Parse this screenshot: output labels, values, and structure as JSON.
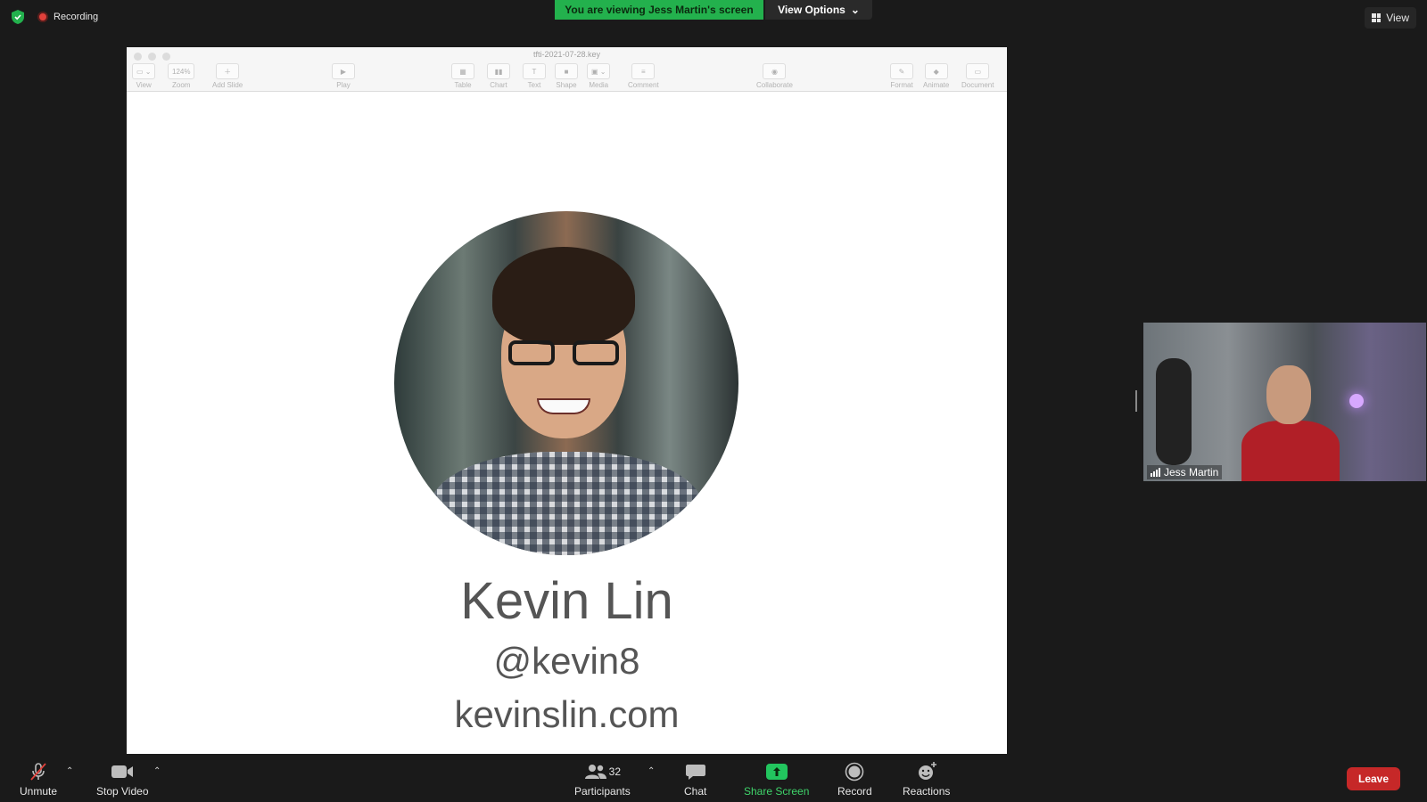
{
  "top_bar": {
    "recording_label": "Recording",
    "viewing_banner": "You are viewing Jess Martin's screen",
    "view_options_label": "View Options",
    "view_label": "View"
  },
  "keynote": {
    "document_title": "tfti-2021-07-28.key",
    "toolbar": [
      {
        "label": "View",
        "name": "view"
      },
      {
        "label": "Zoom",
        "name": "zoom",
        "value": "124%"
      },
      {
        "label": "Add Slide",
        "name": "add-slide"
      },
      {
        "label": "Play",
        "name": "play"
      },
      {
        "label": "Table",
        "name": "table"
      },
      {
        "label": "Chart",
        "name": "chart"
      },
      {
        "label": "Text",
        "name": "text"
      },
      {
        "label": "Shape",
        "name": "shape"
      },
      {
        "label": "Media",
        "name": "media"
      },
      {
        "label": "Comment",
        "name": "comment"
      },
      {
        "label": "Collaborate",
        "name": "collaborate"
      },
      {
        "label": "Format",
        "name": "format"
      },
      {
        "label": "Animate",
        "name": "animate"
      },
      {
        "label": "Document",
        "name": "document"
      }
    ]
  },
  "slide": {
    "name": "Kevin Lin",
    "handle": "@kevin8",
    "website": "kevinslin.com"
  },
  "self_view": {
    "participant_name": "Jess Martin"
  },
  "bottom_bar": {
    "unmute_label": "Unmute",
    "stop_video_label": "Stop Video",
    "participants_label": "Participants",
    "participants_count": "32",
    "chat_label": "Chat",
    "share_screen_label": "Share Screen",
    "record_label": "Record",
    "reactions_label": "Reactions",
    "leave_label": "Leave"
  },
  "colors": {
    "banner_green": "#23b14d",
    "leave_red": "#c62828",
    "share_green": "#22c55e",
    "background": "#1a1a1a"
  }
}
